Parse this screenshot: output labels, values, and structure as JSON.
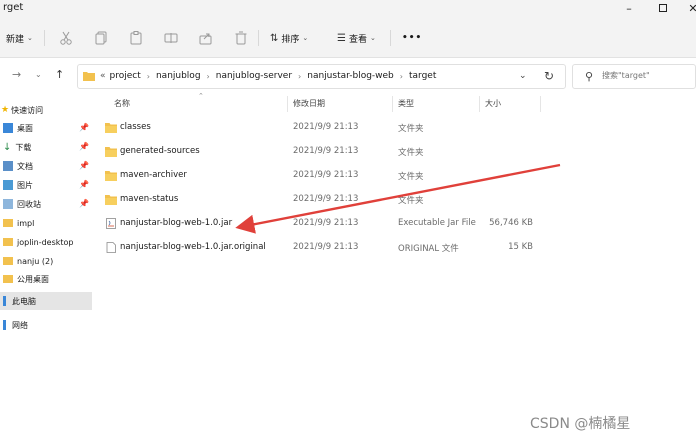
{
  "window": {
    "title": "rget",
    "minimize": "–",
    "close": "✕"
  },
  "toolbar": {
    "new_label": "新建",
    "sort_label": "排序",
    "view_label": "查看",
    "more_label": "•••"
  },
  "address": {
    "overflow": "«",
    "crumbs": [
      "project",
      "nanjublog",
      "nanjublog-server",
      "nanjustar-blog-web",
      "target"
    ]
  },
  "search": {
    "placeholder": "搜索\"target\""
  },
  "sidebar": {
    "quick_access": "快速访问",
    "items": [
      {
        "label": "桌面",
        "pinned": true
      },
      {
        "label": "下载",
        "pinned": true
      },
      {
        "label": "文档",
        "pinned": true
      },
      {
        "label": "图片",
        "pinned": true
      },
      {
        "label": "回收站",
        "pinned": true
      },
      {
        "label": "impl",
        "pinned": false
      },
      {
        "label": "joplin-desktop",
        "pinned": false
      },
      {
        "label": "nanju (2)",
        "pinned": false
      },
      {
        "label": "公用桌面",
        "pinned": false
      }
    ],
    "this_pc": "此电脑",
    "network": "网络"
  },
  "columns": {
    "name": "名称",
    "modified": "修改日期",
    "type": "类型",
    "size": "大小"
  },
  "files": [
    {
      "name": "classes",
      "date": "2021/9/9 21:13",
      "type": "文件夹",
      "size": "",
      "kind": "folder"
    },
    {
      "name": "generated-sources",
      "date": "2021/9/9 21:13",
      "type": "文件夹",
      "size": "",
      "kind": "folder"
    },
    {
      "name": "maven-archiver",
      "date": "2021/9/9 21:13",
      "type": "文件夹",
      "size": "",
      "kind": "folder"
    },
    {
      "name": "maven-status",
      "date": "2021/9/9 21:13",
      "type": "文件夹",
      "size": "",
      "kind": "folder"
    },
    {
      "name": "nanjustar-blog-web-1.0.jar",
      "date": "2021/9/9 21:13",
      "type": "Executable Jar File",
      "size": "56,746 KB",
      "kind": "jar"
    },
    {
      "name": "nanjustar-blog-web-1.0.jar.original",
      "date": "2021/9/9 21:13",
      "type": "ORIGINAL 文件",
      "size": "15 KB",
      "kind": "file"
    }
  ],
  "watermark": "CSDN @楠橘星",
  "colors": {
    "folder": "#f2c14e",
    "folder_dark": "#dca532",
    "arrow": "#e0403a",
    "accent": "#0067c0"
  }
}
